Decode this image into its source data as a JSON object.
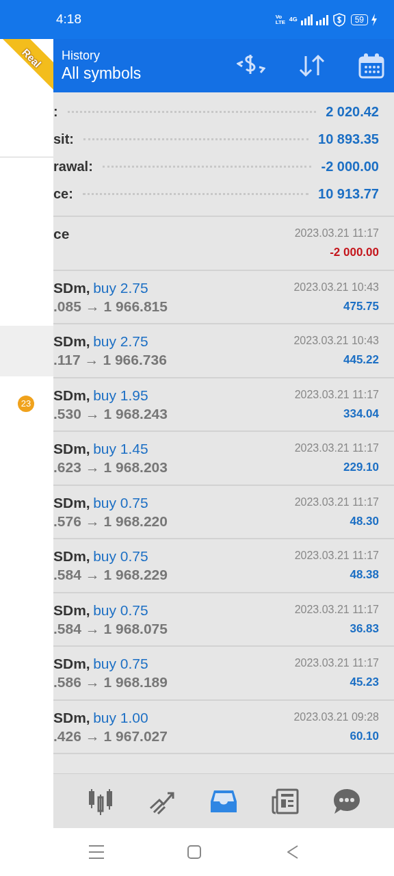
{
  "status_bar": {
    "time": "4:18",
    "volte": "Vo LTE",
    "network": "4G",
    "battery": "59"
  },
  "account_badge": "Real",
  "header": {
    "title": "History",
    "subtitle": "All symbols"
  },
  "drawer": {
    "badge": "23"
  },
  "summary": [
    {
      "label": ":",
      "value": "2 020.42"
    },
    {
      "label": "sit:",
      "value": "10 893.35"
    },
    {
      "label": "rawal:",
      "value": "-2 000.00"
    },
    {
      "label": "ce:",
      "value": "10 913.77"
    }
  ],
  "deals": [
    {
      "kind": "balance",
      "title": "ce",
      "time": "2023.03.21 11:17",
      "amount": "-2 000.00",
      "loss": true
    },
    {
      "kind": "trade",
      "symbol": "SDm,",
      "type": "buy 2.75",
      "prices": ".085 → 1 966.815",
      "time": "2023.03.21 10:43",
      "amount": "475.75",
      "loss": false
    },
    {
      "kind": "trade",
      "symbol": "SDm,",
      "type": "buy 2.75",
      "prices": ".117 → 1 966.736",
      "time": "2023.03.21 10:43",
      "amount": "445.22",
      "loss": false
    },
    {
      "kind": "trade",
      "symbol": "SDm,",
      "type": "buy 1.95",
      "prices": ".530 → 1 968.243",
      "time": "2023.03.21 11:17",
      "amount": "334.04",
      "loss": false
    },
    {
      "kind": "trade",
      "symbol": "SDm,",
      "type": "buy 1.45",
      "prices": ".623 → 1 968.203",
      "time": "2023.03.21 11:17",
      "amount": "229.10",
      "loss": false
    },
    {
      "kind": "trade",
      "symbol": "SDm,",
      "type": "buy 0.75",
      "prices": ".576 → 1 968.220",
      "time": "2023.03.21 11:17",
      "amount": "48.30",
      "loss": false
    },
    {
      "kind": "trade",
      "symbol": "SDm,",
      "type": "buy 0.75",
      "prices": ".584 → 1 968.229",
      "time": "2023.03.21 11:17",
      "amount": "48.38",
      "loss": false
    },
    {
      "kind": "trade",
      "symbol": "SDm,",
      "type": "buy 0.75",
      "prices": ".584 → 1 968.075",
      "time": "2023.03.21 11:17",
      "amount": "36.83",
      "loss": false
    },
    {
      "kind": "trade",
      "symbol": "SDm,",
      "type": "buy 0.75",
      "prices": ".586 → 1 968.189",
      "time": "2023.03.21 11:17",
      "amount": "45.23",
      "loss": false
    },
    {
      "kind": "trade",
      "symbol": "SDm,",
      "type": "buy 1.00",
      "prices": ".426 → 1 967.027",
      "time": "2023.03.21 09:28",
      "amount": "60.10",
      "loss": false
    }
  ],
  "bottom_nav": [
    {
      "selected": false
    },
    {
      "selected": false
    },
    {
      "selected": true
    },
    {
      "selected": false
    },
    {
      "selected": false
    }
  ]
}
